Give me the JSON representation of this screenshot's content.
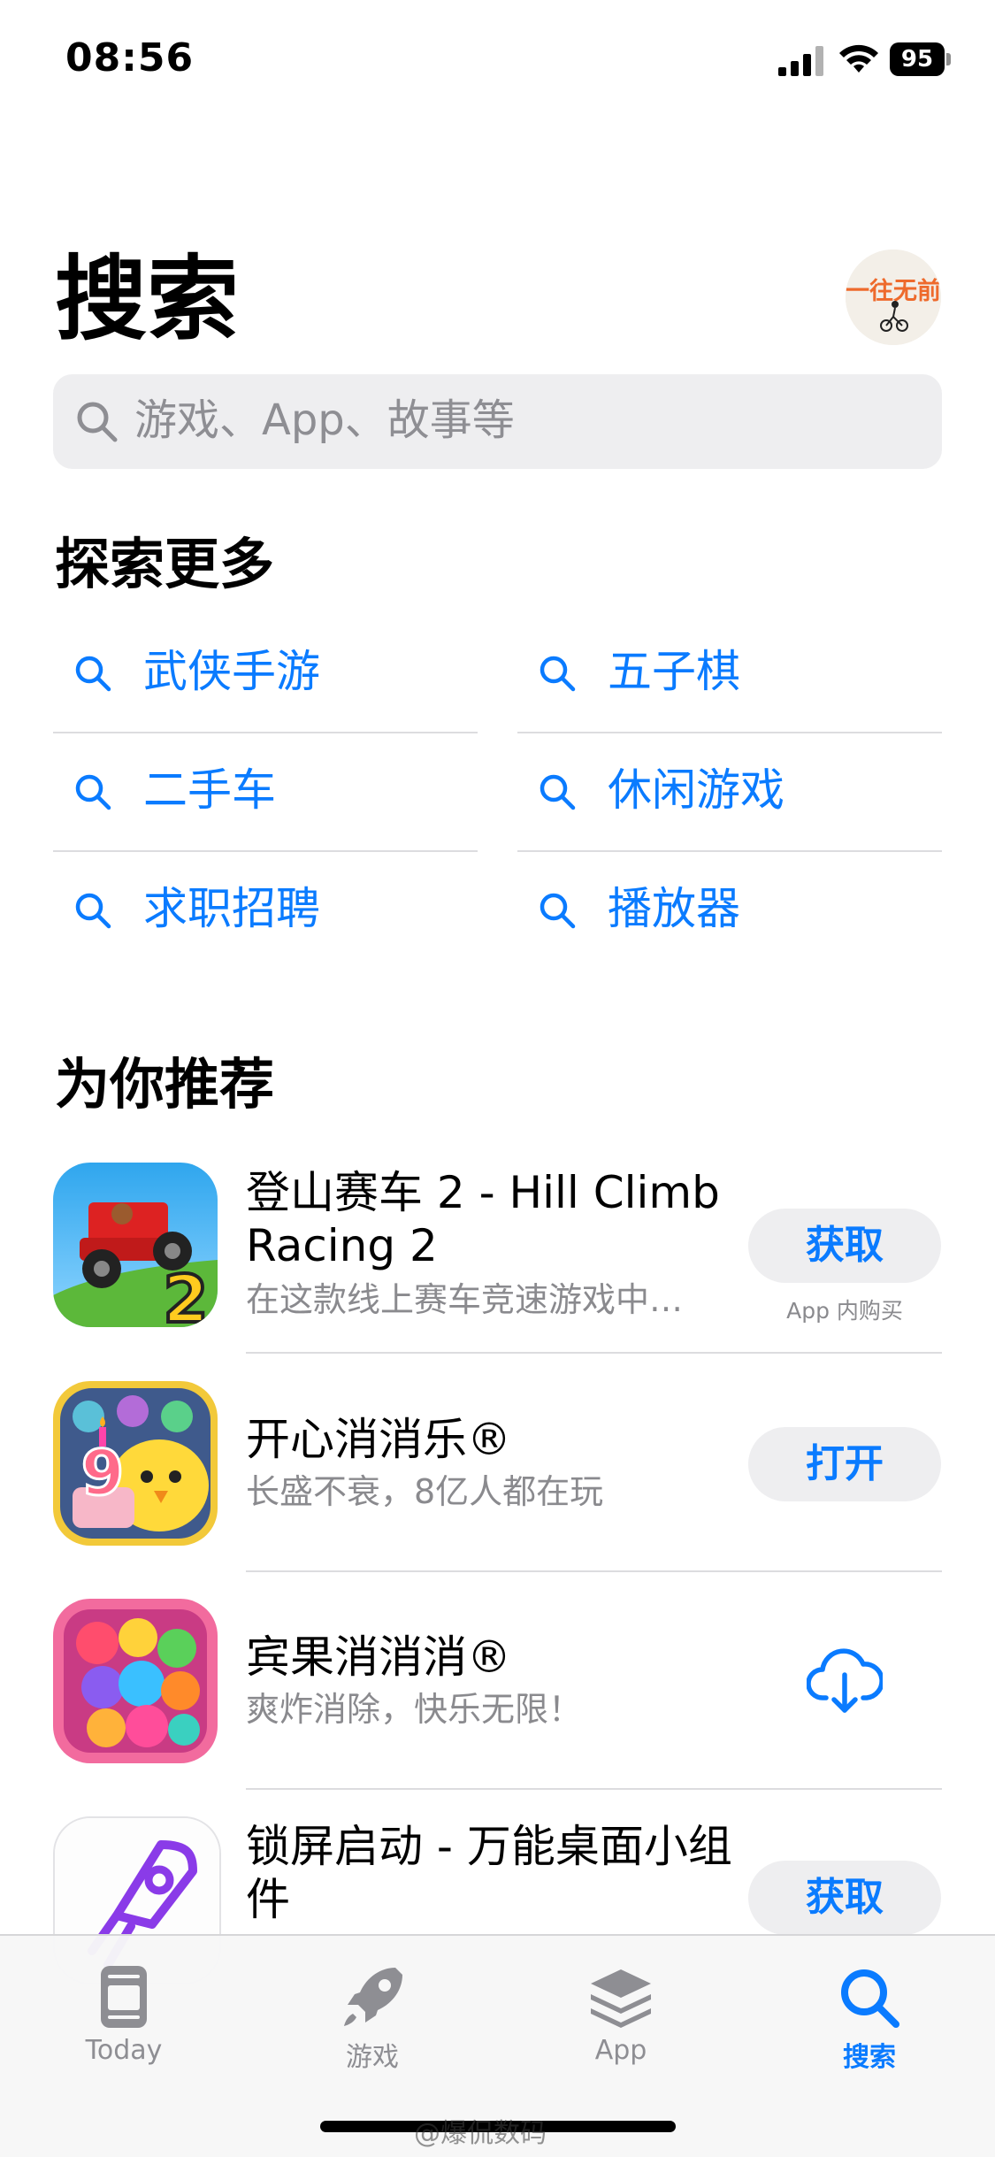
{
  "status_bar": {
    "time": "08:56",
    "battery": "95"
  },
  "header": {
    "title": "搜索",
    "avatar_text": "一往无前"
  },
  "search": {
    "placeholder": "游戏、App、故事等"
  },
  "explore": {
    "title": "探索更多",
    "items": [
      {
        "label": "武侠手游"
      },
      {
        "label": "五子棋"
      },
      {
        "label": "二手车"
      },
      {
        "label": "休闲游戏"
      },
      {
        "label": "求职招聘"
      },
      {
        "label": "播放器"
      }
    ]
  },
  "recommended": {
    "title": "为你推荐",
    "apps": [
      {
        "name": "登山赛车 2 - Hill Climb Racing 2",
        "subtitle": "在这款线上赛车竞速游戏中…",
        "button": "获取",
        "note": "App 内购买"
      },
      {
        "name": "开心消消乐®",
        "subtitle": "长盛不衰，8亿人都在玩",
        "button": "打开"
      },
      {
        "name": "宾果消消消®",
        "subtitle": "爽炸消除，快乐无限！",
        "button_icon": "cloud-download-icon"
      },
      {
        "name": "锁屏启动 - 万能桌面小组件",
        "button": "获取"
      }
    ]
  },
  "tab_bar": {
    "tabs": [
      {
        "label": "Today"
      },
      {
        "label": "游戏"
      },
      {
        "label": "App"
      },
      {
        "label": "搜索",
        "active": true
      }
    ]
  },
  "watermark": "@爆侃数码",
  "colors": {
    "accent": "#0a7bff",
    "secondary_text": "#8a8a8e",
    "search_bg": "#eeeef0"
  }
}
